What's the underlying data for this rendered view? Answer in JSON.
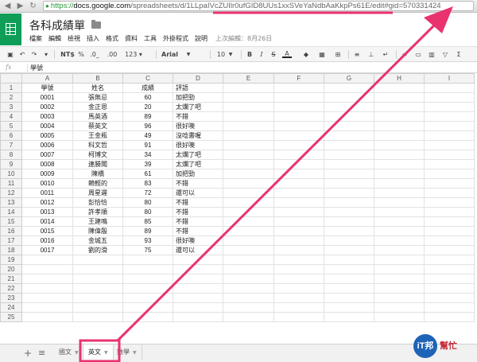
{
  "browser": {
    "back_icon": "arrow-left-icon",
    "forward_icon": "arrow-right-icon",
    "reload_icon": "reload-icon",
    "url_scheme": "https://",
    "url_host": "docs.google.com",
    "url_path": "/spreadsheets/d/1LLpaIVcZUIlr0ufGID8UUs1xxSVeYaNdbAaKkpPs61E/edit#gid=570331424"
  },
  "doc": {
    "title": "各科成績單",
    "menu": [
      "檔案",
      "編輯",
      "檢視",
      "插入",
      "格式",
      "資料",
      "工具",
      "外掛程式",
      "說明"
    ],
    "last_edit": "上次編輯：8月26日"
  },
  "toolbar": {
    "currency": "NT$",
    "percent": "%",
    "decrease_decimal": ".0_",
    "increase_decimal": ".00",
    "more_formats": "123 ▾",
    "font": "Arial",
    "font_size": "10",
    "bold": "B",
    "italic": "I",
    "strike": "S",
    "text_color": "A"
  },
  "formula_bar": {
    "fx": "fx",
    "content": "學號"
  },
  "grid": {
    "columns": [
      "A",
      "B",
      "C",
      "D",
      "E",
      "F",
      "G",
      "H",
      "I"
    ],
    "rows": [
      [
        "學號",
        "姓名",
        "成績",
        "評語"
      ],
      [
        "0001",
        "張無忌",
        "60",
        "加把勁"
      ],
      [
        "0002",
        "金正恩",
        "20",
        "太爛了吧"
      ],
      [
        "0003",
        "馬英酒",
        "89",
        "不錯"
      ],
      [
        "0004",
        "蔡英文",
        "96",
        "很好噢"
      ],
      [
        "0005",
        "王金瓶",
        "49",
        "沒唸書喔"
      ],
      [
        "0006",
        "科文哲",
        "91",
        "很好噢"
      ],
      [
        "0007",
        "柯博文",
        "34",
        "太爛了吧"
      ],
      [
        "0008",
        "連勝聞",
        "39",
        "太爛了吧"
      ],
      [
        "0009",
        "陳橋",
        "61",
        "加把勁"
      ],
      [
        "0010",
        "賴輕的",
        "83",
        "不錯"
      ],
      [
        "0011",
        "周星遲",
        "72",
        "還可以"
      ],
      [
        "0012",
        "彭恰恰",
        "80",
        "不錯"
      ],
      [
        "0013",
        "許孝順",
        "80",
        "不錯"
      ],
      [
        "0014",
        "王建鳴",
        "85",
        "不錯"
      ],
      [
        "0015",
        "陳偉殷",
        "89",
        "不錯"
      ],
      [
        "0016",
        "金城五",
        "93",
        "很好噢"
      ],
      [
        "0017",
        "劉的滑",
        "75",
        "還可以"
      ]
    ],
    "empty_rows": 7
  },
  "tabs": {
    "add_icon": "plus-icon",
    "list_icon": "sheet-list-icon",
    "items": [
      "國文",
      "英文",
      "數學"
    ],
    "active_index": 1
  },
  "watermark": {
    "logo_text": "iT邦",
    "label": "幫忙"
  },
  "colors": {
    "sheets_green": "#0f9d58",
    "annotation_pink": "#e8336f"
  }
}
